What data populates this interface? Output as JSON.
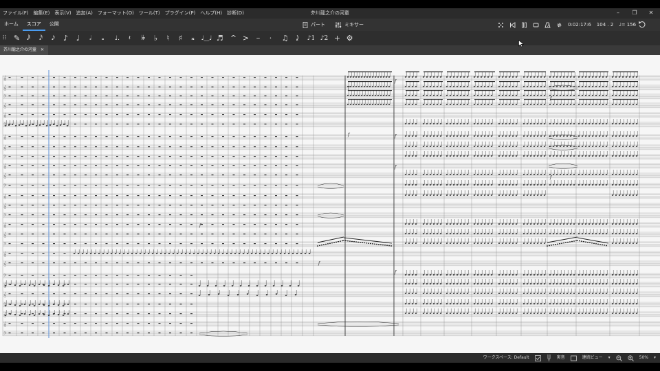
{
  "window": {
    "title": "芥川龍之介の河童",
    "controls": [
      "–",
      "❐",
      "✕"
    ]
  },
  "menu": [
    "ファイル(F)",
    "編集(E)",
    "表示(V)",
    "追加(A)",
    "フォーマット(O)",
    "ツール(T)",
    "プラグイン(P)",
    "ヘルプ(H)",
    "診断(D)"
  ],
  "nav": {
    "tabs": [
      {
        "label": "ホーム",
        "active": false
      },
      {
        "label": "スコア",
        "active": true
      },
      {
        "label": "公開",
        "active": false
      }
    ],
    "parts_label": "パート",
    "mixer_label": "ミキサー"
  },
  "playback": {
    "time": "0:02:17:6",
    "position": "104 . 2",
    "tempo": "♩= 156"
  },
  "note_input_toolbar": [
    {
      "icon": "grip-icon",
      "glyph": "⠿"
    },
    {
      "icon": "pencil-icon",
      "glyph": "✎"
    },
    {
      "icon": "64th-note-icon",
      "glyph": "𝅘𝅥𝅱"
    },
    {
      "icon": "32nd-note-icon",
      "glyph": "𝅘𝅥𝅰"
    },
    {
      "icon": "16th-note-icon",
      "glyph": "𝅘𝅥𝅯"
    },
    {
      "icon": "eighth-note-icon",
      "glyph": "♪"
    },
    {
      "icon": "quarter-note-icon",
      "glyph": "♩"
    },
    {
      "icon": "half-note-icon",
      "glyph": "𝅗𝅥"
    },
    {
      "icon": "whole-note-icon",
      "glyph": "𝅝"
    },
    {
      "icon": "dotted-note-icon",
      "glyph": "♩."
    },
    {
      "icon": "rest-icon",
      "glyph": "𝄽"
    },
    {
      "icon": "double-flat-icon",
      "glyph": "𝄫"
    },
    {
      "icon": "flat-icon",
      "glyph": "♭"
    },
    {
      "icon": "natural-icon",
      "glyph": "♮"
    },
    {
      "icon": "sharp-icon",
      "glyph": "♯"
    },
    {
      "icon": "double-sharp-icon",
      "glyph": "𝄪"
    },
    {
      "icon": "tie-icon",
      "glyph": "♩‿♩"
    },
    {
      "icon": "slur-icon",
      "glyph": "♬"
    },
    {
      "icon": "marcato-icon",
      "glyph": "^"
    },
    {
      "icon": "accent-icon",
      "glyph": ">"
    },
    {
      "icon": "tenuto-icon",
      "glyph": "–"
    },
    {
      "icon": "staccato-icon",
      "glyph": "·"
    },
    {
      "icon": "tuplet-icon",
      "glyph": "♫"
    },
    {
      "icon": "flip-direction-icon",
      "glyph": "⤸"
    },
    {
      "icon": "voice-1-icon",
      "glyph": "♪1"
    },
    {
      "icon": "voice-2-icon",
      "glyph": "♪2"
    },
    {
      "icon": "add-icon",
      "glyph": "+"
    },
    {
      "icon": "settings-icon",
      "glyph": "⚙"
    }
  ],
  "document_tab": {
    "label": "芥川龍之介の河童",
    "close": "✕"
  },
  "status": {
    "workspace": "ワークスペース: Default",
    "concert_pitch": "実音",
    "view_mode": "連続ビュー",
    "zoom": "50%"
  },
  "colors": {
    "accent": "#4a9cf0",
    "title_bar": "#2b2b2b",
    "toolbar": "#2e2e2e",
    "canvas": "#f6f6f6",
    "staff_line": "#9a9a9a",
    "selection": "#5b8fd6"
  }
}
